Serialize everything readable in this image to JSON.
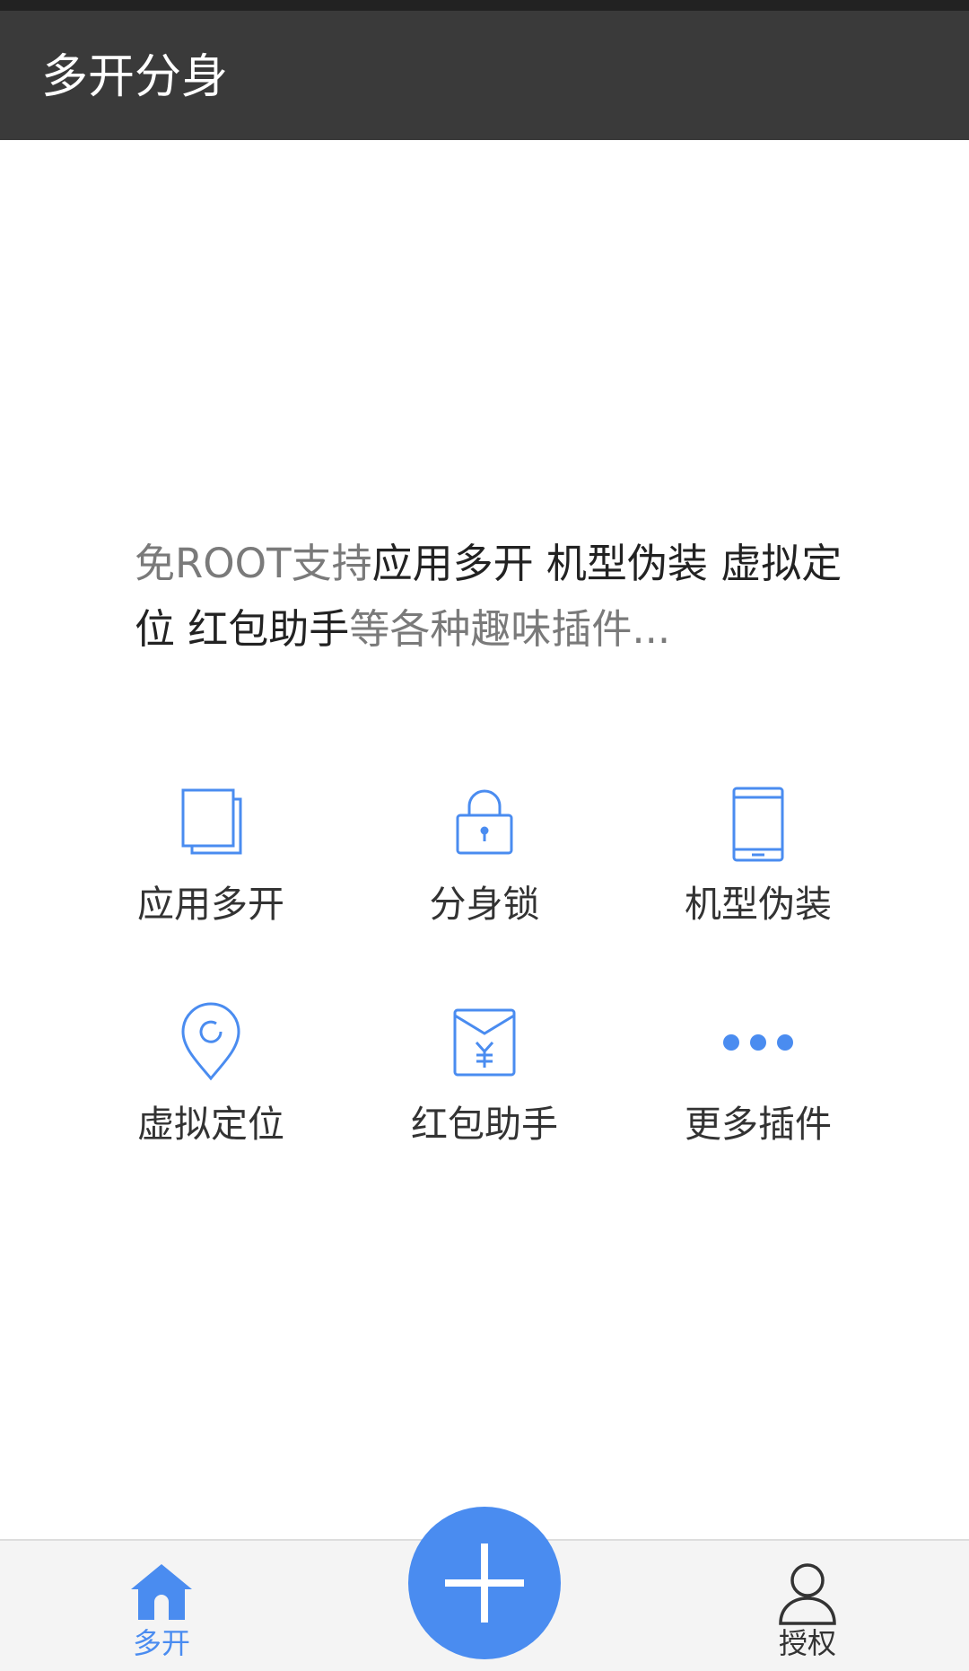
{
  "app_bar": {
    "title": "多开分身"
  },
  "intro": {
    "segments": [
      {
        "text": "免ROOT支持",
        "style": "muted"
      },
      {
        "text": "应用多开 机型伪装 虚拟定位 红包助手",
        "style": "strong"
      },
      {
        "text": "等各种趣味插件...",
        "style": "muted"
      }
    ]
  },
  "features": [
    {
      "label": "应用多开",
      "icon": "copy-icon"
    },
    {
      "label": "分身锁",
      "icon": "lock-icon"
    },
    {
      "label": "机型伪装",
      "icon": "phone-icon"
    },
    {
      "label": "虚拟定位",
      "icon": "location-pin-icon"
    },
    {
      "label": "红包助手",
      "icon": "red-envelope-icon"
    },
    {
      "label": "更多插件",
      "icon": "more-dots-icon"
    }
  ],
  "bottom_nav": {
    "home": {
      "label": "多开",
      "icon": "home-icon"
    },
    "add": {
      "icon": "plus-icon"
    },
    "auth": {
      "label": "授权",
      "icon": "user-icon"
    }
  },
  "colors": {
    "accent": "#4a8cf0",
    "app_bar": "#3a3a3a",
    "text_dark": "#222222",
    "text_muted": "#7a7a7a"
  }
}
